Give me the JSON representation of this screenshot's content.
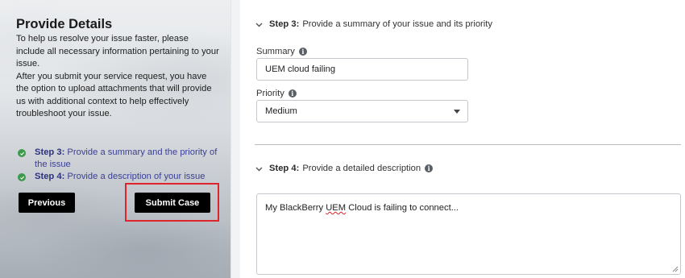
{
  "left_panel": {
    "title": "Provide Details",
    "description_1": "To help us resolve your issue faster, please include all necessary information pertaining to your issue.",
    "description_2": "After you submit your service request, you have the option to upload attachments that will provide us with additional context to help effectively troubleshoot your issue.",
    "steps": [
      {
        "label": "Step 3:",
        "text": "Provide a summary and the priority of the issue"
      },
      {
        "label": "Step 4:",
        "text": "Provide a description of your issue"
      }
    ],
    "previous_label": "Previous",
    "submit_label": "Submit Case"
  },
  "step3": {
    "label": "Step 3:",
    "title": "Provide a summary of your issue and its priority",
    "summary_label": "Summary",
    "summary_value": "UEM cloud failing",
    "priority_label": "Priority",
    "priority_value": "Medium"
  },
  "step4": {
    "label": "Step 4:",
    "title": "Provide a detailed description",
    "description_before": "My BlackBerry ",
    "description_underlined": "UEM",
    "description_after": " Cloud is failing to connect..."
  },
  "icons": {
    "info": "i",
    "step_check": "check-icon",
    "section_toggle": "chevron-down-icon"
  },
  "colors": {
    "button_bg": "#000000",
    "highlight_border": "#e0242b",
    "step_text": "#3a3f92",
    "check_green": "#3d9a4c"
  }
}
